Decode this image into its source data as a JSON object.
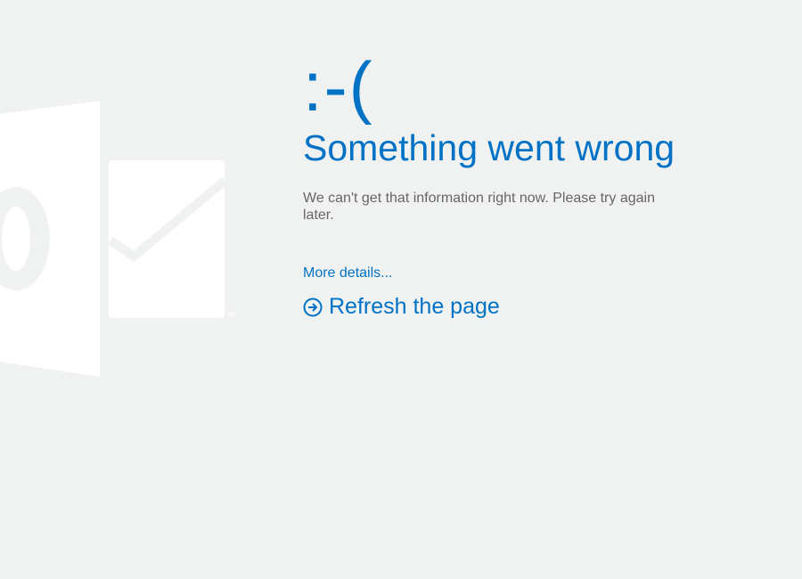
{
  "logo": {
    "icon": "outlook-logo-icon",
    "trademark": "TM"
  },
  "error": {
    "emoticon": ":-(",
    "title": "Something went wrong",
    "message": "We can't get that information right now. Please try again later."
  },
  "links": {
    "more_details": "More details..."
  },
  "refresh": {
    "icon": "arrow-circle-right-icon",
    "label": "Refresh the page"
  },
  "colors": {
    "background": "#f0f1f1",
    "accent": "#0072c6",
    "text": "#666666",
    "logo": "#ffffff"
  }
}
